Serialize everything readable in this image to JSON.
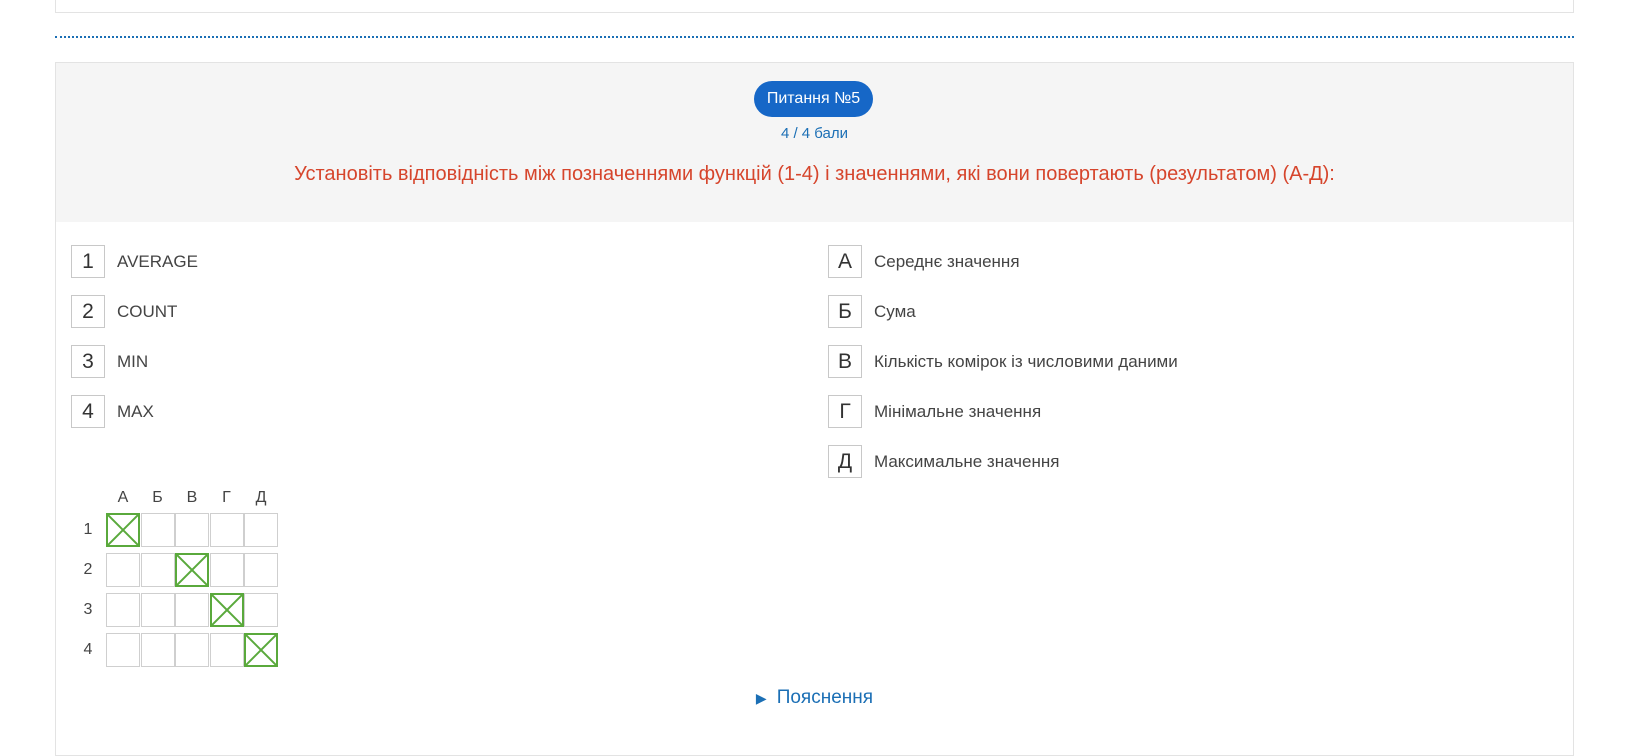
{
  "question": {
    "badge": "Питання №5",
    "score": "4 / 4 бали",
    "text": "Установіть відповідність між позначеннями функцій (1-4) і значеннями, які вони повертають (результатом) (А-Д):"
  },
  "left_items": [
    {
      "key": "1",
      "text": "AVERAGE"
    },
    {
      "key": "2",
      "text": "COUNT"
    },
    {
      "key": "3",
      "text": "MIN"
    },
    {
      "key": "4",
      "text": "MAX"
    }
  ],
  "right_items": [
    {
      "key": "А",
      "text": "Середнє значення"
    },
    {
      "key": "Б",
      "text": "Сума"
    },
    {
      "key": "В",
      "text": "Кількість комірок із числовими даними"
    },
    {
      "key": "Г",
      "text": "Мінімальне значення"
    },
    {
      "key": "Д",
      "text": "Максимальне значення"
    }
  ],
  "grid": {
    "columns": [
      "А",
      "Б",
      "В",
      "Г",
      "Д"
    ],
    "rows": [
      "1",
      "2",
      "3",
      "4"
    ],
    "selected": [
      [
        1,
        0,
        0,
        0,
        0
      ],
      [
        0,
        0,
        1,
        0,
        0
      ],
      [
        0,
        0,
        0,
        1,
        0
      ],
      [
        0,
        0,
        0,
        0,
        1
      ]
    ],
    "check_color": "#5aa93c"
  },
  "explanation": {
    "label": "Пояснення",
    "icon": "triangle-right-icon"
  },
  "colors": {
    "accent": "#1667c7",
    "question_text": "#d6452c",
    "link": "#1b6fb5"
  }
}
